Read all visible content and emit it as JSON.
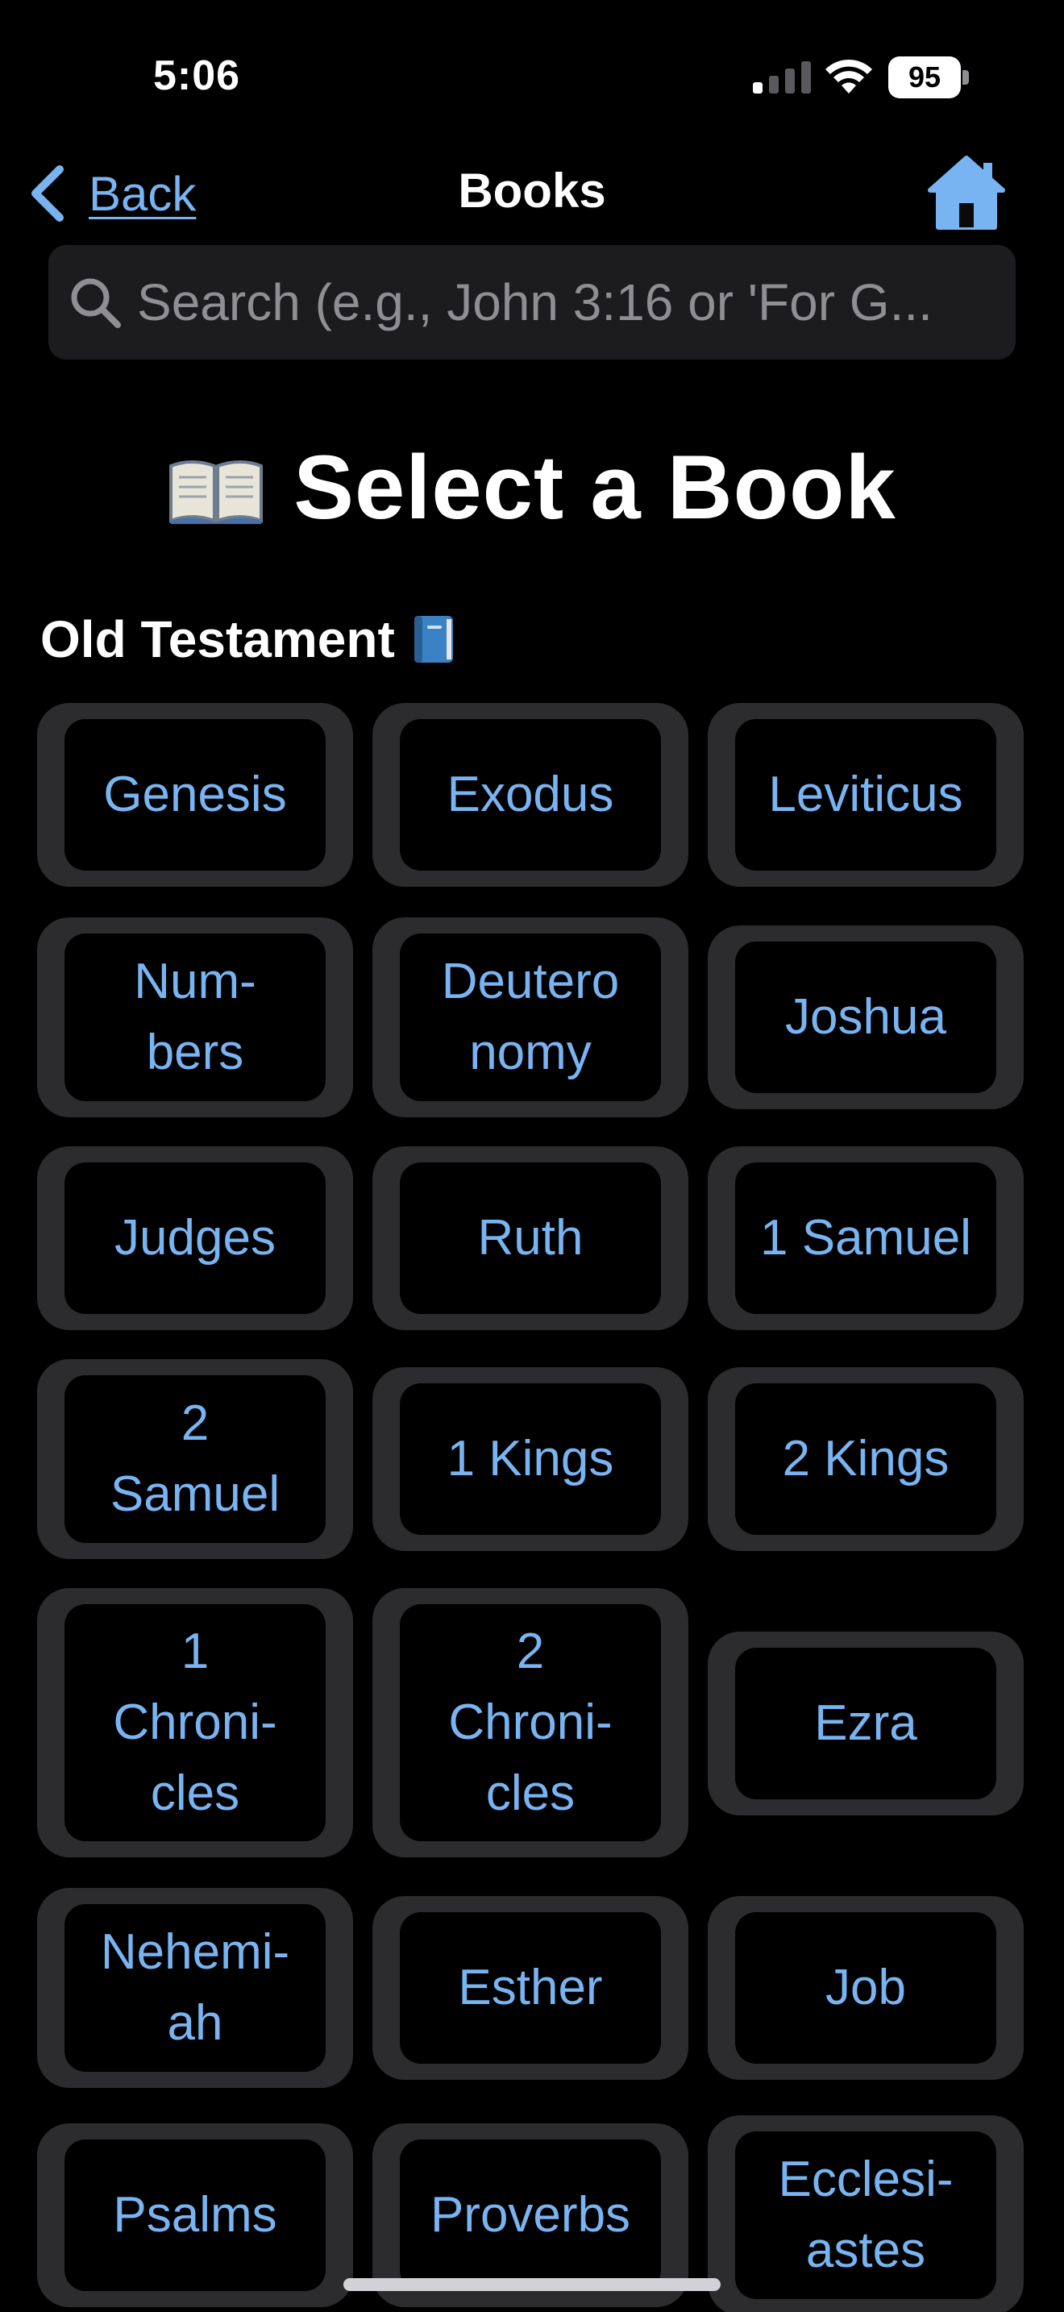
{
  "status_bar": {
    "time": "5:06",
    "battery": "95"
  },
  "nav": {
    "back_label": "Back",
    "title": "Books"
  },
  "search": {
    "placeholder": "Search (e.g., John 3:16 or 'For G...",
    "value": ""
  },
  "heading": {
    "emoji": "📖",
    "title": "Select a Book"
  },
  "section": {
    "title": "Old Testament",
    "emoji": "📘"
  },
  "books": [
    {
      "label": "Genesis"
    },
    {
      "label": "Exodus"
    },
    {
      "label": "Leviticus"
    },
    {
      "label": "Num-\nbers"
    },
    {
      "label": "Deutero\nnomy"
    },
    {
      "label": "Joshua"
    },
    {
      "label": "Judges"
    },
    {
      "label": "Ruth"
    },
    {
      "label": "1 Samuel"
    },
    {
      "label": "2\nSamuel"
    },
    {
      "label": "1 Kings"
    },
    {
      "label": "2 Kings"
    },
    {
      "label": "1\nChroni-\ncles"
    },
    {
      "label": "2\nChroni-\ncles"
    },
    {
      "label": "Ezra"
    },
    {
      "label": "Nehemi-\nah"
    },
    {
      "label": "Esther"
    },
    {
      "label": "Job"
    },
    {
      "label": "Psalms"
    },
    {
      "label": "Proverbs"
    },
    {
      "label": "Ecclesi-\nastes"
    }
  ],
  "colors": {
    "accent": "#79b4f2",
    "card_border": "#2c2c2e",
    "background": "#000000"
  }
}
